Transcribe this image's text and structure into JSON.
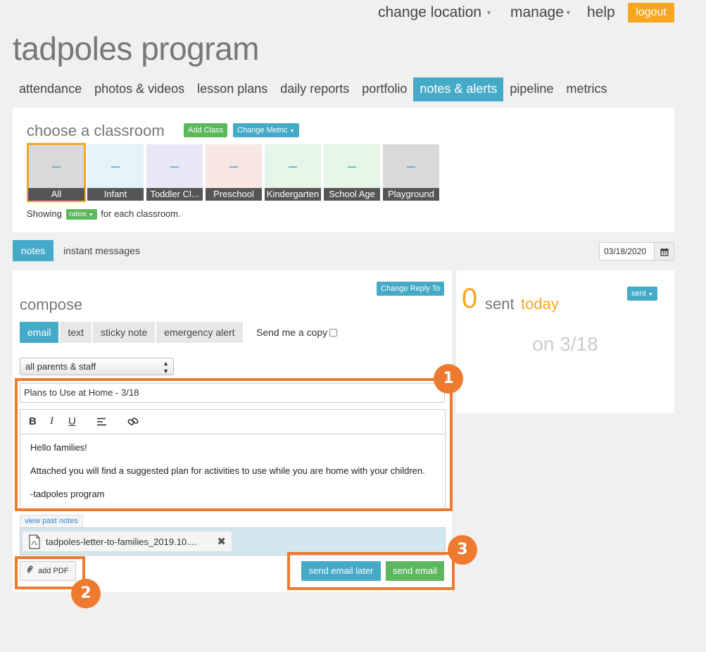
{
  "topnav": {
    "change_location": "change location",
    "manage": "manage",
    "help": "help",
    "logout": "logout"
  },
  "brand": {
    "title": "tadpoles program"
  },
  "main_tabs": [
    "attendance",
    "photos & videos",
    "lesson plans",
    "daily reports",
    "portfolio",
    "notes & alerts",
    "pipeline",
    "metrics"
  ],
  "active_main_tab": "notes & alerts",
  "classroom": {
    "title": "choose a classroom",
    "add_class": "Add Class",
    "change_metric": "Change Metric",
    "tiles": [
      {
        "label": "All",
        "value": "–",
        "color": "#d9d9d9"
      },
      {
        "label": "Infant",
        "value": "–",
        "color": "#e3f3f8"
      },
      {
        "label": "Toddler Cl...",
        "value": "–",
        "color": "#ebe6f6"
      },
      {
        "label": "Preschool",
        "value": "–",
        "color": "#f8e6e4"
      },
      {
        "label": "Kindergarten",
        "value": "–",
        "color": "#e5f5e8"
      },
      {
        "label": "School Age",
        "value": "–",
        "color": "#e5f5e8"
      },
      {
        "label": "Playground",
        "value": "–",
        "color": "#d9d9d9"
      }
    ],
    "showing_prefix": "Showing",
    "metric": "ratios",
    "showing_suffix": "for each classroom."
  },
  "subtabs": {
    "notes": "notes",
    "instant_messages": "instant messages"
  },
  "date": {
    "value": "03/18/2020"
  },
  "compose": {
    "title": "compose",
    "change_reply_to": "Change Reply To",
    "tabs": [
      "email",
      "text",
      "sticky note",
      "emergency alert"
    ],
    "active_tab": "email",
    "send_copy_label": "Send me a copy",
    "recipient": "all parents & staff",
    "subject": "Plans to Use at Home - 3/18",
    "body": [
      "Hello families!",
      "Attached you will find a suggested plan for activities to use while you are home with your children.",
      "-tadpoles program"
    ],
    "view_past_notes": "view past notes",
    "attachment_name": "tadpoles-letter-to-families_2019.10....",
    "add_pdf": "add PDF",
    "send_later": "send email later",
    "send_now": "send email"
  },
  "sent": {
    "count": "0",
    "word": "sent",
    "period": "today",
    "filter": "sent",
    "on_date": "on 3/18"
  },
  "callouts": [
    "1",
    "2",
    "3"
  ],
  "colors": {
    "accent_blue": "#45a9c8",
    "accent_green": "#5cb85c",
    "accent_orange": "#f5a623",
    "callout": "#ee7a2f"
  }
}
